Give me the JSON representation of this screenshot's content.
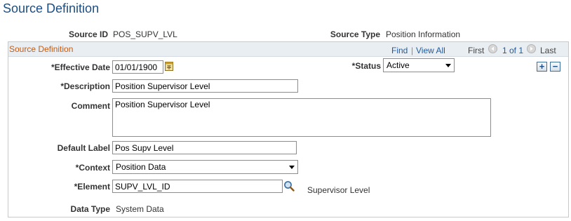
{
  "page": {
    "title": "Source Definition"
  },
  "summary": {
    "source_id_label": "Source ID",
    "source_id_value": "POS_SUPV_LVL",
    "source_type_label": "Source Type",
    "source_type_value": "Position Information"
  },
  "section": {
    "title": "Source Definition",
    "nav": {
      "find": "Find",
      "separator": "|",
      "view_all": "View All",
      "first": "First",
      "range": "1 of 1",
      "last": "Last"
    }
  },
  "form": {
    "effective_date_label": "*Effective Date",
    "effective_date_value": "01/01/1900",
    "status_label": "*Status",
    "status_value": "Active",
    "add_row_symbol": "+",
    "delete_row_symbol": "−",
    "description_label": "*Description",
    "description_value": "Position Supervisor Level",
    "comment_label": "Comment",
    "comment_value": "Position Supervisor Level",
    "default_label_label": "Default Label",
    "default_label_value": "Pos Supv Level",
    "context_label": "*Context",
    "context_value": "Position Data",
    "element_label": "*Element",
    "element_value": "SUPV_LVL_ID",
    "element_description": "Supervisor Level",
    "data_type_label": "Data Type",
    "data_type_value": "System Data"
  },
  "icons": {
    "calendar": "calendar-icon",
    "lookup": "magnifier-icon",
    "prev": "chevron-left-icon",
    "next": "chevron-right-icon",
    "add": "plus-icon",
    "delete": "minus-icon"
  },
  "colors": {
    "title": "#1c4e82",
    "section_title": "#c75b12",
    "link": "#1f5a9e",
    "header_bg": "#e9eef3"
  }
}
